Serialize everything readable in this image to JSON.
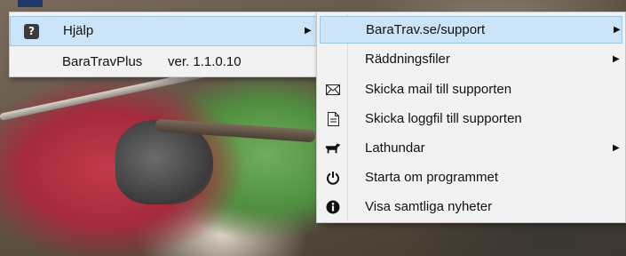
{
  "background": {
    "description_icon": "photo-background"
  },
  "left_menu": {
    "help": {
      "icon": "question-icon",
      "icon_glyph": "?",
      "label": "Hjälp",
      "arrow": "▶"
    },
    "version": {
      "app_name": "BaraTravPlus",
      "version_text": "ver. 1.1.0.10"
    }
  },
  "submenu": {
    "items": [
      {
        "label": "BaraTrav.se/support",
        "icon": "",
        "has_arrow": true,
        "arrow": "▶",
        "selected": true
      },
      {
        "label": "Räddningsfiler",
        "icon": "",
        "has_arrow": true,
        "arrow": "▶",
        "selected": false
      },
      {
        "label": "Skicka mail till supporten",
        "icon": "envelope-icon",
        "has_arrow": false,
        "selected": false
      },
      {
        "label": "Skicka loggfil till supporten",
        "icon": "document-icon",
        "has_arrow": false,
        "selected": false
      },
      {
        "label": "Lathundar",
        "icon": "horse-icon",
        "has_arrow": true,
        "arrow": "▶",
        "selected": false
      },
      {
        "label": "Starta om programmet",
        "icon": "power-icon",
        "has_arrow": false,
        "selected": false
      },
      {
        "label": "Visa samtliga nyheter",
        "icon": "info-icon",
        "has_arrow": false,
        "selected": false
      }
    ]
  },
  "colors": {
    "menu_bg": "#f2f2f2",
    "highlight_bg": "#cce4f7",
    "highlight_border": "#99c9ef"
  }
}
